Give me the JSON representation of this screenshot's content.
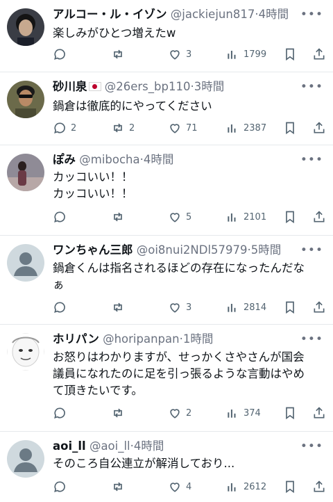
{
  "tweets": [
    {
      "name": "アルコー・ル・イゾン",
      "flag": false,
      "handle": "@jackiejun817",
      "time": "4時間",
      "text": "楽しみがひとつ増えたw",
      "replies": "",
      "retweets": "",
      "likes": "3",
      "views": "1799"
    },
    {
      "name": "砂川泉",
      "flag": true,
      "handle": "@26ers_bp110",
      "time": "3時間",
      "text": "鍋倉は徹底的にやってください",
      "replies": "2",
      "retweets": "2",
      "likes": "71",
      "views": "2387"
    },
    {
      "name": "ぽみ",
      "flag": false,
      "handle": "@mibocha",
      "time": "4時間",
      "text": "カッコいい！！\nカッコいい！！",
      "replies": "",
      "retweets": "",
      "likes": "5",
      "views": "2101"
    },
    {
      "name": "ワンちゃん三郎",
      "flag": false,
      "handle": "@oi8nui2NDl57979",
      "time": "5時間",
      "text": "鍋倉くんは指名されるほどの存在になったんだな\nぁ",
      "replies": "",
      "retweets": "",
      "likes": "3",
      "views": "2814"
    },
    {
      "name": "ホリパン",
      "flag": false,
      "handle": "@horipanpan",
      "time": "1時間",
      "text": "お怒りはわかりますが、せっかくさやさんが国会\n議員になれたのに足を引っ張るような言動はやめ\nて頂きたいです。",
      "replies": "",
      "retweets": "",
      "likes": "2",
      "views": "374"
    },
    {
      "name": "aoi_ll",
      "flag": false,
      "handle": "@aoi_ll",
      "time": "4時間",
      "text": "そのころ自公連立が解消しており...",
      "replies": "",
      "retweets": "",
      "likes": "4",
      "views": "2612"
    }
  ],
  "separator": "·",
  "icons": {
    "reply": "reply-icon",
    "retweet": "retweet-icon",
    "like": "heart-icon",
    "views": "views-icon",
    "bookmark": "bookmark-icon",
    "share": "share-icon",
    "more": "more-icon"
  },
  "colors": {
    "text": "#0f1419",
    "muted": "#536471",
    "divider": "#e6e9ec",
    "default_avatar": "#cfd9de"
  }
}
